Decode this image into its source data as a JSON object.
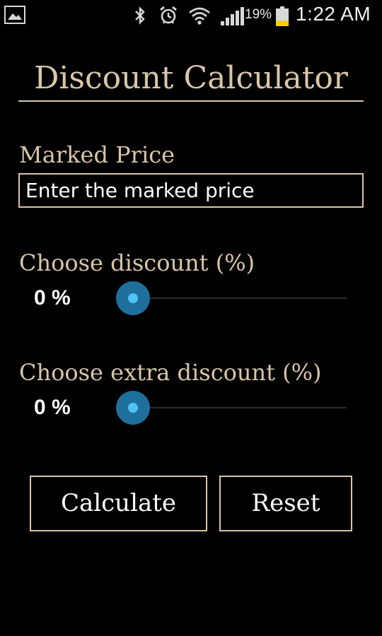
{
  "status_bar": {
    "battery_percent": "19%",
    "time": "1:22 AM",
    "icons": [
      "gallery-icon",
      "bluetooth-icon",
      "alarm-icon",
      "wifi-icon",
      "signal-icon",
      "battery-icon"
    ],
    "battery_level": 0.19,
    "battery_color": "#f5d000"
  },
  "app": {
    "title": "Discount Calculator",
    "marked_price": {
      "label": "Marked Price",
      "placeholder": "Enter the marked price",
      "value": ""
    },
    "discount": {
      "label": "Choose discount (%)",
      "value_text": "0 %",
      "value": 0,
      "max": 100
    },
    "extra_discount": {
      "label": "Choose extra discount (%)",
      "value_text": "0 %",
      "value": 0,
      "max": 100
    },
    "buttons": {
      "calculate": "Calculate",
      "reset": "Reset"
    }
  },
  "colors": {
    "accent": "#d9c6a8",
    "background": "#000000",
    "slider_thumb": "#1f6f9c",
    "slider_thumb_center": "#4ec4f5"
  }
}
